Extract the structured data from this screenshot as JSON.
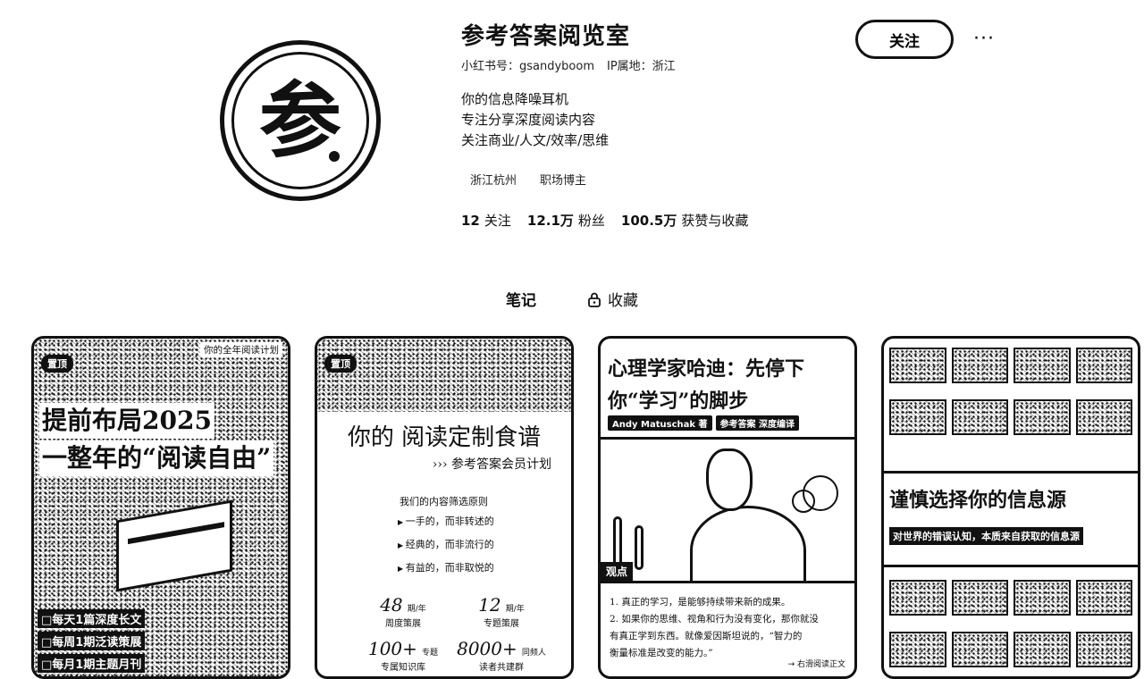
{
  "profile": {
    "avatar_char": "参",
    "nickname": "参考答案阅览室",
    "redbook_id": "小红书号：gsandyboom",
    "ip_location": "IP属地：浙江",
    "bio": [
      "你的信息降噪耳机",
      "专注分享深度阅读内容",
      "关注商业/人文/效率/思维"
    ],
    "tags": [
      "浙江杭州",
      "职场博主"
    ],
    "stats": [
      {
        "value": "12",
        "label": "关注"
      },
      {
        "value": "12.1万",
        "label": "粉丝"
      },
      {
        "value": "100.5万",
        "label": "获赞与收藏"
      }
    ]
  },
  "actions": {
    "follow_label": "关注",
    "more_label": "···"
  },
  "tabs": [
    {
      "label": "笔记",
      "active": true
    },
    {
      "label": "收藏",
      "active": false,
      "icon": "lock-icon"
    }
  ],
  "cards": {
    "card1": {
      "badge": "置顶",
      "corner": "你的全年阅读计划",
      "title": [
        "提前布局2025",
        "一整年的“阅读自由”"
      ],
      "list": [
        "每天1篇深度长文",
        "每周1期泛读策展",
        "每月1期主题月刊"
      ]
    },
    "card2": {
      "badge": "置顶",
      "title": "你的 阅读定制食谱",
      "subtitle": "››› 参考答案会员计划",
      "rules_head": "我们的内容筛选原则",
      "rules": [
        "一手的，而非转述的",
        "经典的，而非流行的",
        "有益的，而非取悦的"
      ],
      "stats": [
        {
          "num": "48",
          "unit": "期/年",
          "label": "周度策展"
        },
        {
          "num": "12",
          "unit": "期/年",
          "label": "专题策展"
        },
        {
          "num": "100+",
          "unit": "专题",
          "label": "专属知识库"
        },
        {
          "num": "8000+",
          "unit": "同频人",
          "label": "读者共建群"
        }
      ]
    },
    "card3": {
      "title": [
        "心理学家哈迪：先停下",
        "你“学习”的脚步"
      ],
      "byline": [
        "Andy Matuschak 著",
        "参考答案 深度编译"
      ],
      "tag": "观点",
      "points": [
        "1. 真正的学习，是能够持续带来新的成果。",
        "2. 如果你的思维、视角和行为没有变化，那你就没",
        "   有真正学到东西。就像爱因斯坦说的，“智力的",
        "   衡量标准是改变的能力。”"
      ],
      "read_more": "→ 右滑阅读正文"
    },
    "card4": {
      "title": "谨慎选择你的信息源",
      "subtitle": "对世界的错误认知，本质来自获取的信息源"
    }
  }
}
